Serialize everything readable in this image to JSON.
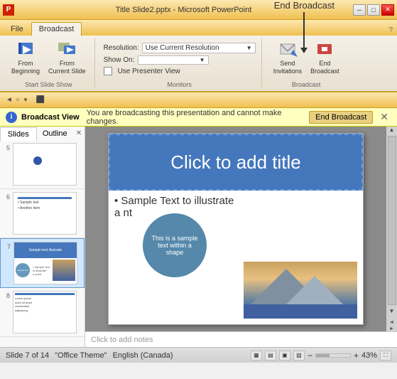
{
  "titleBar": {
    "title": "Title Slide2.pptx - Microsoft PowerPoint",
    "icon": "P",
    "minBtn": "─",
    "maxBtn": "□",
    "closeBtn": "✕"
  },
  "ribbonTabs": {
    "tabs": [
      "File",
      "Broadcast"
    ]
  },
  "ribbon": {
    "groups": {
      "startSlideShow": {
        "label": "Start Slide Show",
        "fromBeginning": "From\nBeginning",
        "fromCurrentSlide": "From\nCurrent Slide"
      },
      "monitors": {
        "label": "Monitors",
        "resolution": "Resolution:",
        "resolutionValue": "Use Current Resolution",
        "showOn": "Show On:",
        "usePresenterView": "Use Presenter View"
      },
      "broadcast": {
        "label": "Broadcast",
        "sendInvitations": "Send\nInvitations",
        "endBroadcast": "End\nBroadcast"
      }
    }
  },
  "quickAccess": {
    "items": [
      "◄",
      "○",
      "▼",
      "⬛"
    ]
  },
  "annotation": {
    "text": "End Broadcast"
  },
  "notificationBar": {
    "iconText": "i",
    "broadcastLabel": "Broadcast View",
    "message": "You are broadcasting this presentation and cannot make changes.",
    "endBroadcastBtn": "End Broadcast",
    "closeBtn": "✕"
  },
  "sidebar": {
    "tabs": [
      "Slides",
      "Outline"
    ],
    "slides": [
      {
        "num": "5",
        "type": "blank-dot"
      },
      {
        "num": "6",
        "type": "text"
      },
      {
        "num": "7",
        "type": "main",
        "active": true
      },
      {
        "num": "8",
        "type": "text-small"
      }
    ]
  },
  "mainSlide": {
    "title": "Click to add title",
    "bullet": "• Sample Text to illustrate",
    "bulletContinued": "a         nt",
    "circleText": "This is a sample text within a shape"
  },
  "notesArea": {
    "placeholder": "Click to add notes"
  },
  "statusBar": {
    "slideInfo": "Slide 7 of 14",
    "theme": "\"Office Theme\"",
    "language": "English (Canada)",
    "zoom": "43%",
    "viewBtns": [
      "▦",
      "▤",
      "▣",
      "▧"
    ]
  }
}
